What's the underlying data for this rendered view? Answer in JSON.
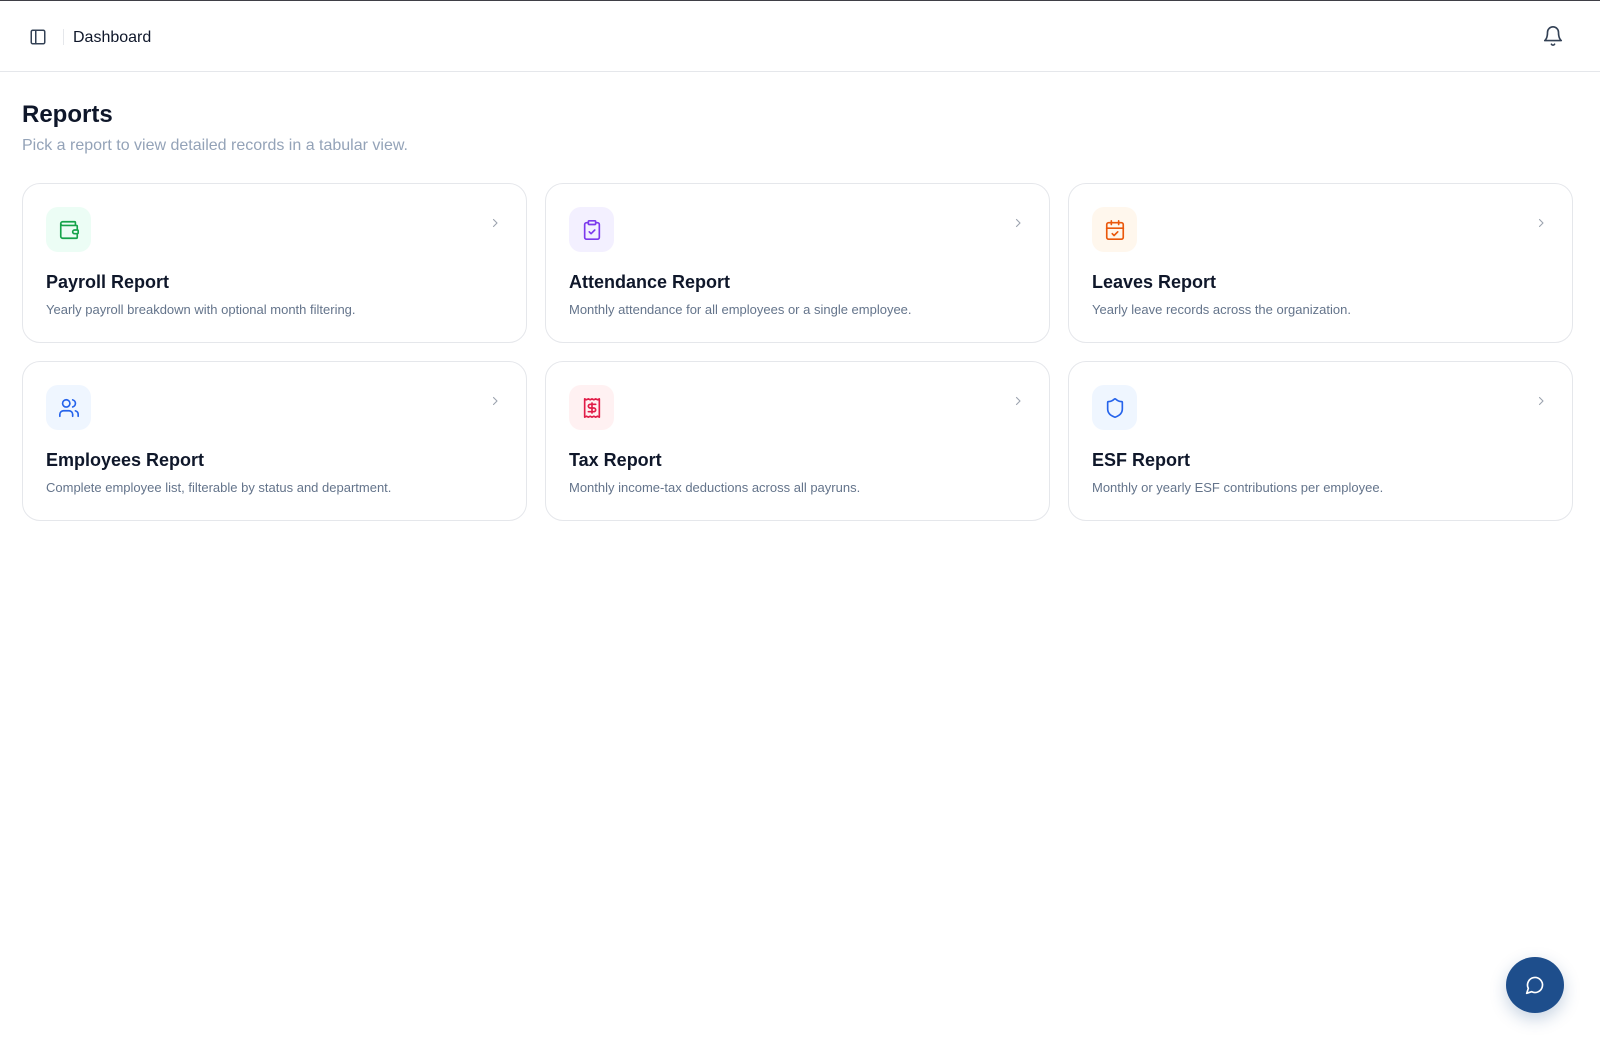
{
  "header": {
    "sidebar_toggle_icon": "panel-left-icon",
    "breadcrumb": "Dashboard",
    "notification_icon": "bell-icon"
  },
  "page": {
    "title": "Reports",
    "subtitle": "Pick a report to view detailed records in a tabular view."
  },
  "reports": [
    {
      "title": "Payroll Report",
      "description": "Yearly payroll breakdown with optional month filtering.",
      "icon": "wallet-icon",
      "color": "#16a34a",
      "bg": "#ecfdf5"
    },
    {
      "title": "Attendance Report",
      "description": "Monthly attendance for all employees or a single employee.",
      "icon": "clipboard-check-icon",
      "color": "#7c3aed",
      "bg": "#f3f0ff"
    },
    {
      "title": "Leaves Report",
      "description": "Yearly leave records across the organization.",
      "icon": "calendar-check-icon",
      "color": "#ea580c",
      "bg": "#fff7ed"
    },
    {
      "title": "Employees Report",
      "description": "Complete employee list, filterable by status and department.",
      "icon": "users-icon",
      "color": "#2563eb",
      "bg": "#eff6ff"
    },
    {
      "title": "Tax Report",
      "description": "Monthly income-tax deductions across all payruns.",
      "icon": "receipt-dollar-icon",
      "color": "#e11d48",
      "bg": "#fff1f2"
    },
    {
      "title": "ESF Report",
      "description": "Monthly or yearly ESF contributions per employee.",
      "icon": "shield-icon",
      "color": "#2563eb",
      "bg": "#eff6ff"
    }
  ],
  "chat": {
    "icon": "message-circle-icon",
    "color": "#1e4e8c"
  }
}
